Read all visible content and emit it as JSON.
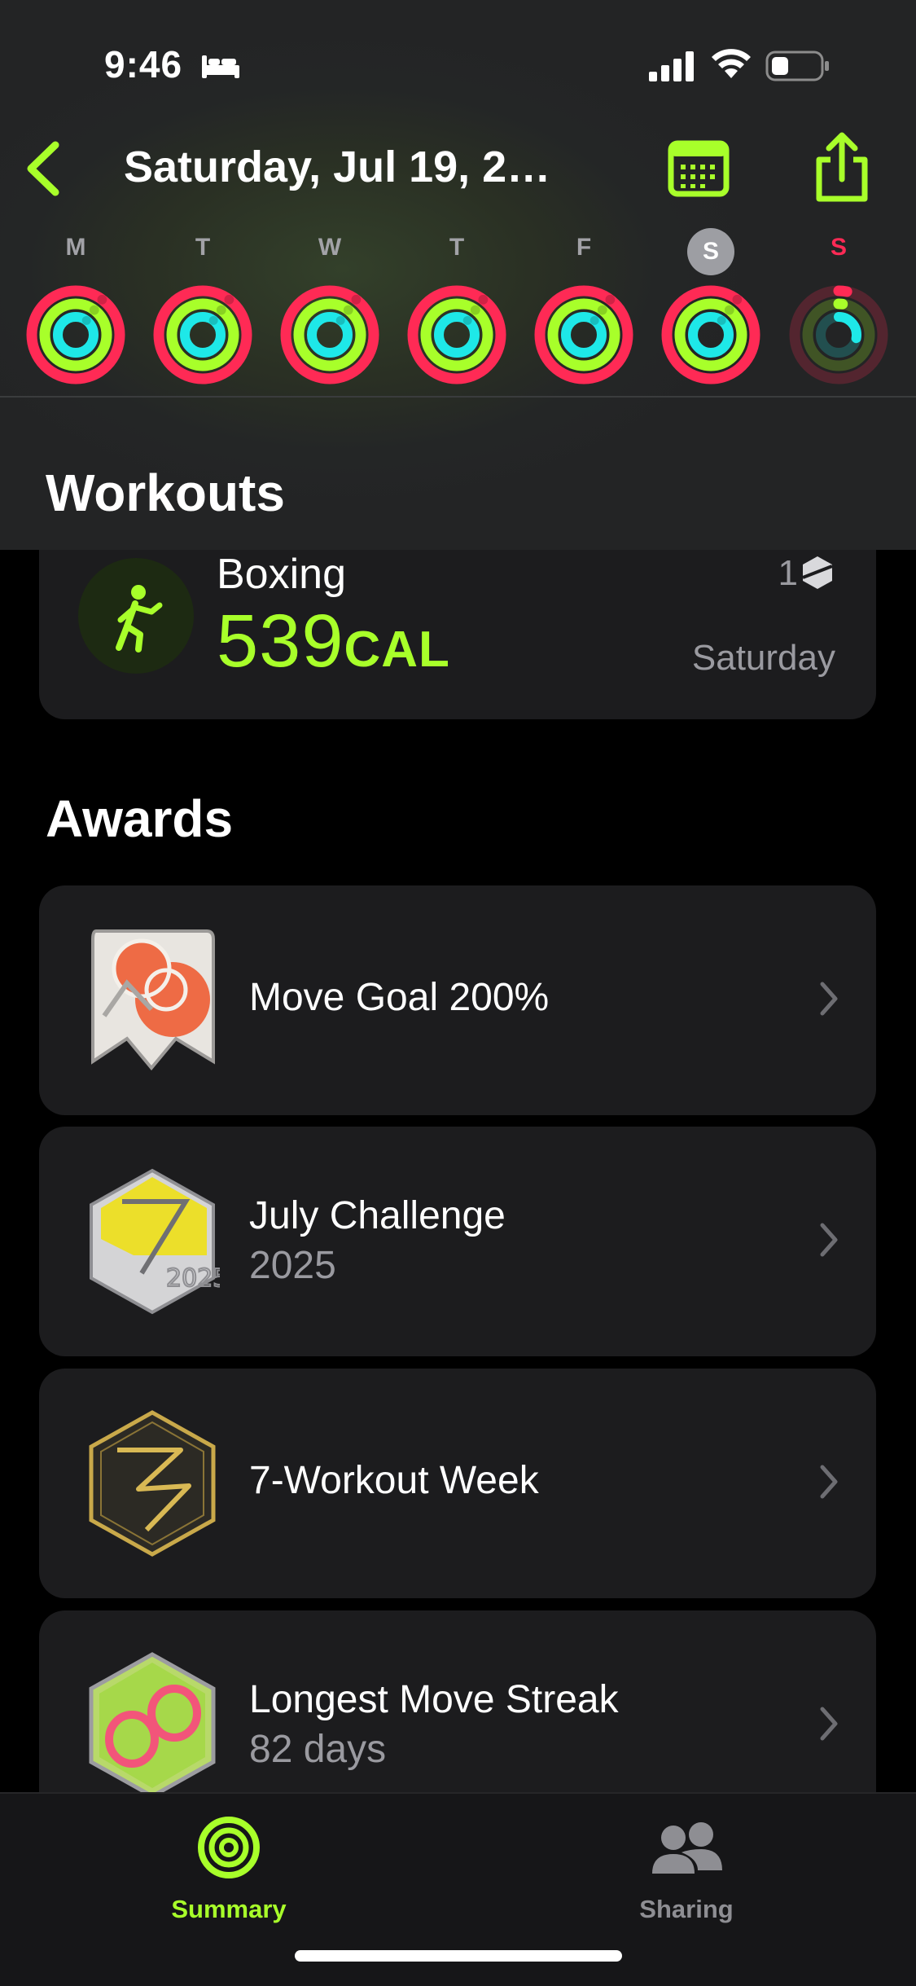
{
  "status_bar": {
    "time": "9:46"
  },
  "nav": {
    "title": "Saturday, Jul 19, 2…"
  },
  "week": {
    "days": [
      "M",
      "T",
      "W",
      "T",
      "F",
      "S",
      "S"
    ],
    "selected_index": 5
  },
  "sections": {
    "workouts": "Workouts",
    "awards": "Awards"
  },
  "workout": {
    "name": "Boxing",
    "calories": "539",
    "calories_unit": "CAL",
    "count": "1",
    "day": "Saturday"
  },
  "awards": [
    {
      "title": "Move Goal 200%",
      "subtitle": ""
    },
    {
      "title": "July Challenge",
      "subtitle": "2025"
    },
    {
      "title": "7-Workout Week",
      "subtitle": ""
    },
    {
      "title": "Longest Move Streak",
      "subtitle": "82 days"
    }
  ],
  "tabs": [
    {
      "label": "Summary",
      "active": true
    },
    {
      "label": "Sharing",
      "active": false
    }
  ],
  "colors": {
    "accent": "#a8ff2a",
    "move": "#ff2a55",
    "exercise": "#a8ff2a",
    "stand": "#1ee8e8"
  }
}
